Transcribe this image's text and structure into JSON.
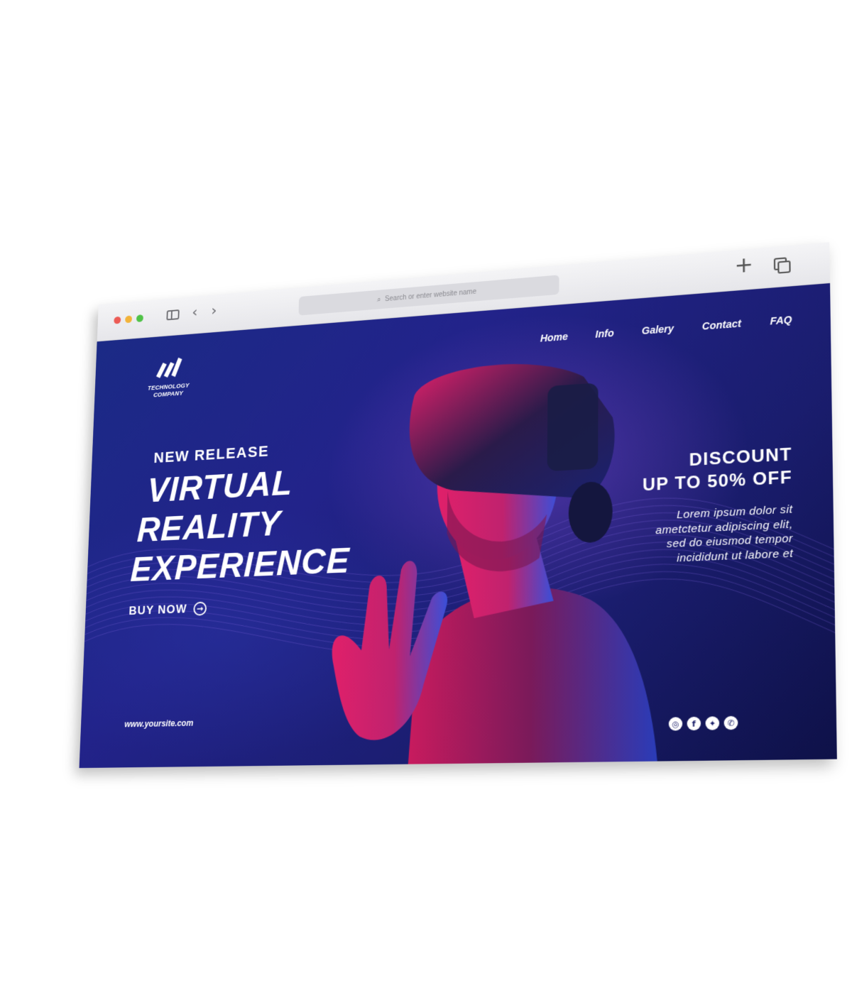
{
  "browser": {
    "address_placeholder": "Search or enter website name",
    "new_tab_glyph": "+",
    "back_glyph": "‹",
    "forward_glyph": "›"
  },
  "site": {
    "logo_text_line1": "TECHNOLOGY",
    "logo_text_line2": "COMPANY",
    "nav": [
      "Home",
      "Info",
      "Galery",
      "Contact",
      "FAQ"
    ],
    "hero": {
      "eyebrow": "NEW RELEASE",
      "headline": [
        "VIRTUAL",
        "REALITY",
        "EXPERIENCE"
      ],
      "cta": "BUY NOW"
    },
    "promo": {
      "line1": "DISCOUNT",
      "line2": "UP TO 50% OFF",
      "body": [
        "Lorem ipsum dolor sit",
        "ametctetur adipiscing elit,",
        "sed do eiusmod tempor",
        "incididunt ut labore et"
      ]
    },
    "url": "www.yoursite.com",
    "socials": [
      {
        "icon": "instagram-icon",
        "glyph": "◎"
      },
      {
        "icon": "facebook-icon",
        "glyph": "f"
      },
      {
        "icon": "twitter-icon",
        "glyph": "✦"
      },
      {
        "icon": "whatsapp-icon",
        "glyph": "✆"
      }
    ]
  },
  "colors": {
    "bg_primary": "#1b2a86",
    "bg_dark": "#0e1148",
    "accent_magenta": "#e0206a",
    "accent_blue": "#2b6bff"
  }
}
